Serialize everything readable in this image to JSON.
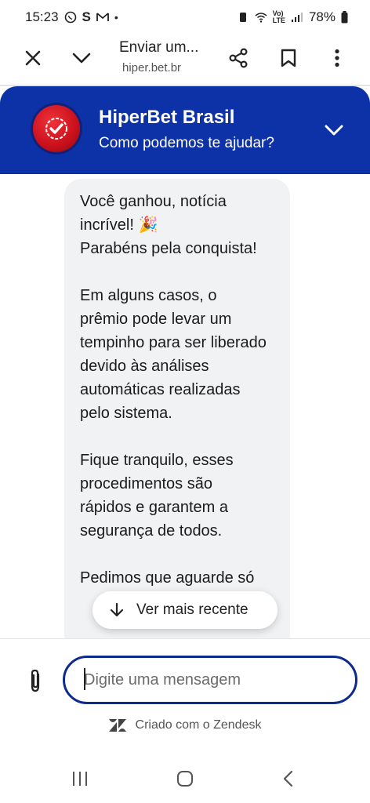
{
  "status_bar": {
    "time": "15:23",
    "app_letter": "S",
    "battery": "78%"
  },
  "browser": {
    "page_title": "Enviar um...",
    "url": "hiper.bet.br"
  },
  "chat_header": {
    "brand_name": "HiperBet Brasil",
    "subtitle": "Como podemos te ajudar?",
    "accent_color": "#0d32a8"
  },
  "message": {
    "paragraphs": [
      {
        "lines": [
          "Você ganhou, notícia",
          "incrível! 🎉",
          "Parabéns pela conquista!"
        ]
      },
      {
        "lines": [
          "Em alguns casos, o",
          "prêmio pode levar um",
          "tempinho para ser liberado",
          "devido às análises",
          "automáticas realizadas",
          "pelo sistema."
        ]
      },
      {
        "lines": [
          "Fique tranquilo, esses",
          "procedimentos são",
          "rápidos e garantem a",
          "segurança de todos."
        ]
      },
      {
        "lines": [
          "Pedimos que aguarde só"
        ]
      }
    ]
  },
  "scroll_button": {
    "label": "Ver mais recente"
  },
  "composer": {
    "placeholder": "Digite uma mensagem",
    "border_color": "#0d2a8e"
  },
  "footer": {
    "credit": "Criado com o Zendesk"
  },
  "icons": {
    "close": "close-icon",
    "collapse": "chevron-down-icon",
    "share": "share-icon",
    "bookmark": "bookmark-icon",
    "menu": "more-vert-icon",
    "attach": "paperclip-icon",
    "arrow": "arrow-down-icon",
    "zendesk": "zendesk-logo-icon"
  }
}
